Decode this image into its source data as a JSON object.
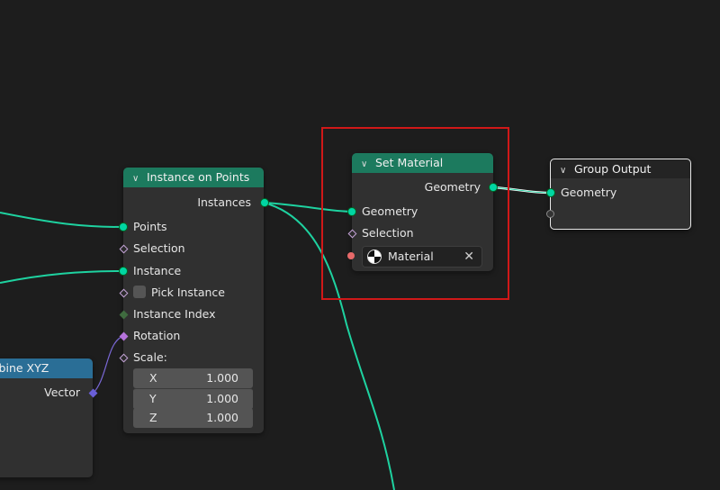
{
  "nodes": {
    "instance_on_points": {
      "title": "Instance on Points",
      "output_instances": "Instances",
      "inputs": {
        "points": "Points",
        "selection": "Selection",
        "instance": "Instance",
        "pick_instance": "Pick Instance",
        "instance_index": "Instance Index",
        "rotation": "Rotation",
        "scale": "Scale:"
      },
      "scale": [
        {
          "axis": "X",
          "value": "1.000"
        },
        {
          "axis": "Y",
          "value": "1.000"
        },
        {
          "axis": "Z",
          "value": "1.000"
        }
      ]
    },
    "set_material": {
      "title": "Set Material",
      "output_geometry": "Geometry",
      "input_geometry": "Geometry",
      "input_selection": "Selection",
      "material": "Material"
    },
    "group_output": {
      "title": "Group Output",
      "input_geometry": "Geometry"
    },
    "combine_xyz": {
      "title": "Combine XYZ",
      "output_vector": "Vector"
    }
  },
  "colors": {
    "geometry_socket": "#00d6a3",
    "geometry_link": "#1ed2a0",
    "node_header_geometry": "#1c7a5e",
    "node_header_converter": "#2a6e96",
    "selection_highlight": "#d01818"
  }
}
